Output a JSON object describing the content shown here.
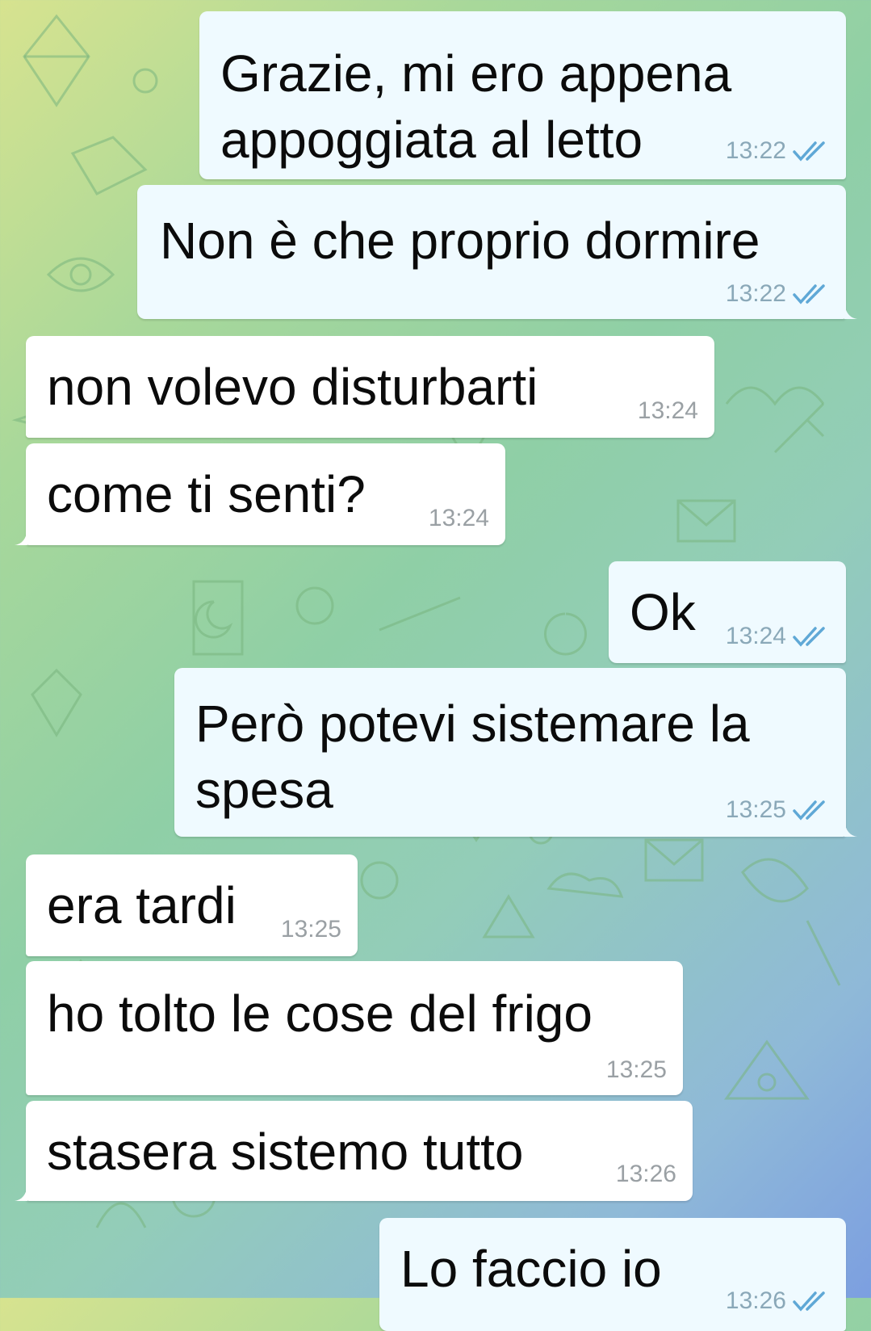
{
  "theme": {
    "outgoing_bubble": "#effaff",
    "incoming_bubble": "#ffffff",
    "checkmark": "#5fa8d6"
  },
  "messages": [
    {
      "direction": "out",
      "lines": [
        "Grazie, mi ero appena",
        "appoggiata al letto"
      ],
      "time": "13:22",
      "read": true
    },
    {
      "direction": "out",
      "lines": [
        "Non è che proprio dormire"
      ],
      "time": "13:22",
      "read": true
    },
    {
      "direction": "in",
      "lines": [
        "non volevo  disturbarti"
      ],
      "time": "13:24"
    },
    {
      "direction": "in",
      "lines": [
        "come ti senti?"
      ],
      "time": "13:24"
    },
    {
      "direction": "out",
      "lines": [
        "Ok"
      ],
      "time": "13:24",
      "read": true
    },
    {
      "direction": "out",
      "lines": [
        "Però potevi sistemare la",
        "spesa"
      ],
      "time": "13:25",
      "read": true
    },
    {
      "direction": "in",
      "lines": [
        "era tardi"
      ],
      "time": "13:25"
    },
    {
      "direction": "in",
      "lines": [
        "ho tolto le cose del frigo"
      ],
      "time": "13:25"
    },
    {
      "direction": "in",
      "lines": [
        "stasera sistemo tutto"
      ],
      "time": "13:26"
    },
    {
      "direction": "out",
      "lines": [
        "Lo faccio io"
      ],
      "time": "13:26",
      "read": true
    }
  ]
}
